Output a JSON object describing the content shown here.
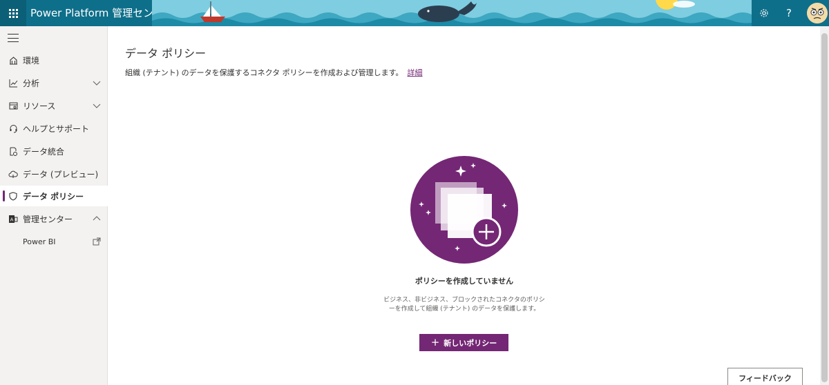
{
  "header": {
    "app_title": "Power Platform 管理センター",
    "help_label": "?",
    "icons": {
      "waffle": "app-launcher-icon",
      "settings": "gear-icon",
      "help": "help-icon",
      "avatar": "user-avatar"
    }
  },
  "sidebar": {
    "items": [
      {
        "label": "環境",
        "icon": "environment-icon"
      },
      {
        "label": "分析",
        "icon": "analytics-icon",
        "chevron": "down"
      },
      {
        "label": "リソース",
        "icon": "resources-icon",
        "chevron": "down"
      },
      {
        "label": "ヘルプとサポート",
        "icon": "headset-icon"
      },
      {
        "label": "データ統合",
        "icon": "data-integration-icon"
      },
      {
        "label": "データ (プレビュー)",
        "icon": "cloud-data-icon"
      },
      {
        "label": "データ ポリシー",
        "icon": "shield-icon",
        "active": true
      },
      {
        "label": "管理センター",
        "icon": "admin-center-icon",
        "chevron": "up"
      }
    ],
    "sub_items": [
      {
        "label": "Power BI",
        "icon": "external-link-icon"
      }
    ]
  },
  "main": {
    "title": "データ ポリシー",
    "description": "組織 (テナント) のデータを保護するコネクタ ポリシーを作成および管理します。",
    "details_link": "詳細",
    "empty_state": {
      "title": "ポリシーを作成していません",
      "description": "ビジネス、非ビジネス、ブロックされたコネクタのポリシーを作成して組織 (テナント) のデータを保護します。"
    },
    "new_policy_button": "新しいポリシー",
    "new_policy_plus": "+"
  },
  "feedback_button": "フィードバック",
  "colors": {
    "header_bg": "#0e6f8a",
    "accent": "#742774",
    "sidebar_bg": "#f3f2f1"
  }
}
